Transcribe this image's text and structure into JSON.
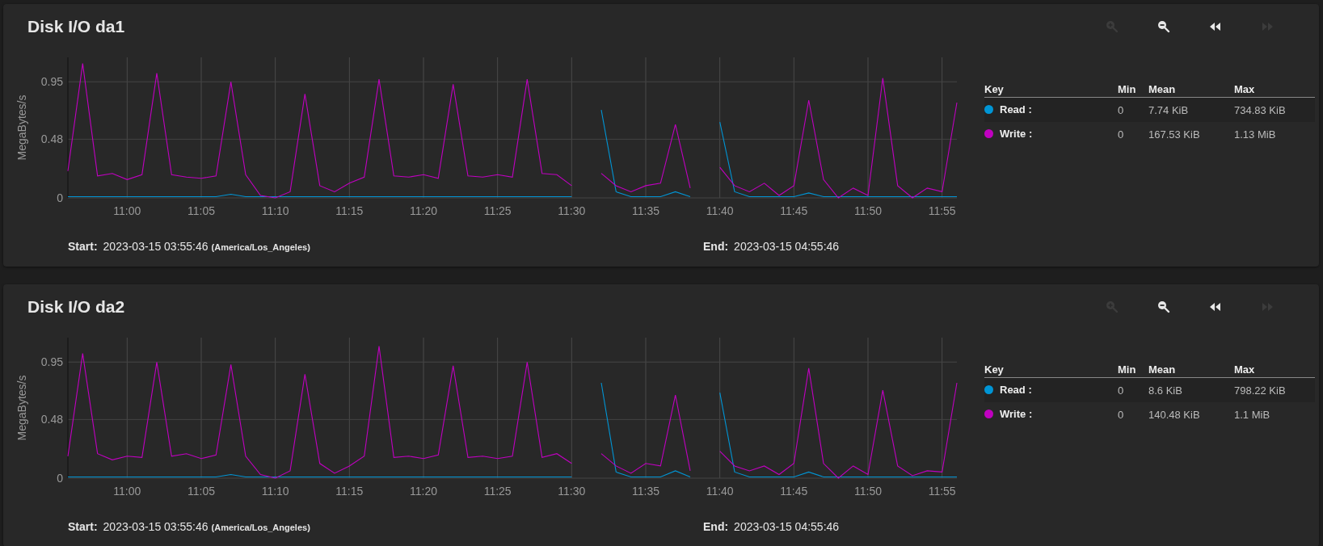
{
  "panels": [
    {
      "title": "Disk I/O da1",
      "toolbar": [
        {
          "kind": "zoom-in",
          "disabled": true
        },
        {
          "kind": "zoom-out",
          "disabled": false
        },
        {
          "kind": "rewind",
          "disabled": false
        },
        {
          "kind": "fast-forward",
          "disabled": true
        }
      ],
      "chart_data": {
        "type": "line",
        "grid": true,
        "ylabel": "MegaBytes/s",
        "ylim": [
          0,
          1.15
        ],
        "yticks": [
          0,
          0.48,
          0.95
        ],
        "categories": [
          null,
          null,
          null,
          null,
          "11:00",
          null,
          null,
          null,
          null,
          "11:05",
          null,
          null,
          null,
          null,
          "11:10",
          null,
          null,
          null,
          null,
          "11:15",
          null,
          null,
          null,
          null,
          "11:20",
          null,
          null,
          null,
          null,
          "11:25",
          null,
          null,
          null,
          null,
          "11:30",
          null,
          null,
          null,
          null,
          "11:35",
          null,
          null,
          null,
          null,
          "11:40",
          null,
          null,
          null,
          null,
          "11:45",
          null,
          null,
          null,
          null,
          "11:50",
          null,
          null,
          null,
          null,
          "11:55",
          null
        ],
        "series": [
          {
            "color": "#0095d5",
            "values": [
              0.01,
              0.01,
              0.01,
              0.01,
              0.01,
              0.01,
              0.01,
              0.01,
              0.01,
              0.01,
              0.01,
              0.03,
              0.01,
              0.01,
              0.01,
              0.01,
              0.01,
              0.01,
              0.01,
              0.01,
              0.01,
              0.01,
              0.01,
              0.01,
              0.01,
              0.01,
              0.01,
              0.01,
              0.01,
              0.01,
              0.01,
              0.01,
              0.01,
              0.01,
              0.01,
              null,
              0.72,
              0.05,
              0.01,
              0.01,
              0.01,
              0.05,
              0.01,
              null,
              0.62,
              0.05,
              0.01,
              0.01,
              0.01,
              0.01,
              0.04,
              0.01,
              0.01,
              0.01,
              0.01,
              0.01,
              0.01,
              0.01,
              0.01,
              0.01,
              0.01
            ]
          },
          {
            "color": "#c000c0",
            "values": [
              0.22,
              1.1,
              0.18,
              0.2,
              0.15,
              0.19,
              1.02,
              0.19,
              0.17,
              0.16,
              0.18,
              0.95,
              0.19,
              0.02,
              0,
              0.05,
              0.85,
              0.1,
              0.05,
              0.12,
              0.17,
              0.97,
              0.18,
              0.17,
              0.19,
              0.16,
              0.93,
              0.18,
              0.17,
              0.19,
              0.17,
              0.97,
              0.2,
              0.19,
              0.1,
              null,
              0.2,
              0.1,
              0.05,
              0.1,
              0.12,
              0.6,
              0.08,
              null,
              0.25,
              0.1,
              0.05,
              0.12,
              0.02,
              0.1,
              0.8,
              0.15,
              0,
              0.08,
              0.02,
              0.98,
              0.1,
              0,
              0.08,
              0.05,
              0.78
            ]
          }
        ]
      },
      "start_label": "Start:",
      "start_value": "2023-03-15 03:55:46",
      "timezone": "(America/Los_Angeles)",
      "end_label": "End:",
      "end_value": "2023-03-15 04:55:46",
      "legend": {
        "columns": [
          "Key",
          "Min",
          "Mean",
          "Max"
        ],
        "rows": [
          {
            "name": "Read :",
            "color": "#0095d5",
            "min": "0",
            "mean": "7.74 KiB",
            "max": "734.83 KiB"
          },
          {
            "name": "Write :",
            "color": "#c000c0",
            "min": "0",
            "mean": "167.53 KiB",
            "max": "1.13 MiB"
          }
        ]
      }
    },
    {
      "title": "Disk I/O da2",
      "toolbar": [
        {
          "kind": "zoom-in",
          "disabled": true
        },
        {
          "kind": "zoom-out",
          "disabled": false
        },
        {
          "kind": "rewind",
          "disabled": false
        },
        {
          "kind": "fast-forward",
          "disabled": true
        }
      ],
      "chart_data": {
        "type": "line",
        "grid": true,
        "ylabel": "MegaBytes/s",
        "ylim": [
          0,
          1.15
        ],
        "yticks": [
          0,
          0.48,
          0.95
        ],
        "categories": [
          null,
          null,
          null,
          null,
          "11:00",
          null,
          null,
          null,
          null,
          "11:05",
          null,
          null,
          null,
          null,
          "11:10",
          null,
          null,
          null,
          null,
          "11:15",
          null,
          null,
          null,
          null,
          "11:20",
          null,
          null,
          null,
          null,
          "11:25",
          null,
          null,
          null,
          null,
          "11:30",
          null,
          null,
          null,
          null,
          "11:35",
          null,
          null,
          null,
          null,
          "11:40",
          null,
          null,
          null,
          null,
          "11:45",
          null,
          null,
          null,
          null,
          "11:50",
          null,
          null,
          null,
          null,
          "11:55",
          null
        ],
        "series": [
          {
            "color": "#0095d5",
            "values": [
              0.01,
              0.01,
              0.01,
              0.01,
              0.01,
              0.01,
              0.01,
              0.01,
              0.01,
              0.01,
              0.01,
              0.03,
              0.01,
              0.01,
              0.01,
              0.01,
              0.01,
              0.01,
              0.01,
              0.01,
              0.01,
              0.01,
              0.01,
              0.01,
              0.01,
              0.01,
              0.01,
              0.01,
              0.01,
              0.01,
              0.01,
              0.01,
              0.01,
              0.01,
              0.01,
              null,
              0.78,
              0.05,
              0.01,
              0.01,
              0.01,
              0.06,
              0.01,
              null,
              0.7,
              0.05,
              0.01,
              0.01,
              0.01,
              0.01,
              0.05,
              0.01,
              0.01,
              0.01,
              0.01,
              0.01,
              0.01,
              0.01,
              0.01,
              0.01,
              0.01
            ]
          },
          {
            "color": "#c000c0",
            "values": [
              0.18,
              1.02,
              0.2,
              0.15,
              0.18,
              0.17,
              0.95,
              0.18,
              0.2,
              0.16,
              0.19,
              0.93,
              0.18,
              0.03,
              0,
              0.06,
              0.85,
              0.12,
              0.04,
              0.1,
              0.18,
              1.08,
              0.17,
              0.18,
              0.16,
              0.19,
              0.92,
              0.17,
              0.18,
              0.16,
              0.18,
              0.95,
              0.17,
              0.2,
              0.12,
              null,
              0.2,
              0.1,
              0.04,
              0.12,
              0.1,
              0.68,
              0.06,
              null,
              0.22,
              0.1,
              0.06,
              0.1,
              0.03,
              0.12,
              0.9,
              0.12,
              0,
              0.1,
              0.03,
              0.72,
              0.1,
              0.02,
              0.06,
              0.05,
              0.78
            ]
          }
        ]
      },
      "start_label": "Start:",
      "start_value": "2023-03-15 03:55:46",
      "timezone": "(America/Los_Angeles)",
      "end_label": "End:",
      "end_value": "2023-03-15 04:55:46",
      "legend": {
        "columns": [
          "Key",
          "Min",
          "Mean",
          "Max"
        ],
        "rows": [
          {
            "name": "Read :",
            "color": "#0095d5",
            "min": "0",
            "mean": "8.6 KiB",
            "max": "798.22 KiB"
          },
          {
            "name": "Write :",
            "color": "#c000c0",
            "min": "0",
            "mean": "140.48 KiB",
            "max": "1.1 MiB"
          }
        ]
      }
    }
  ]
}
